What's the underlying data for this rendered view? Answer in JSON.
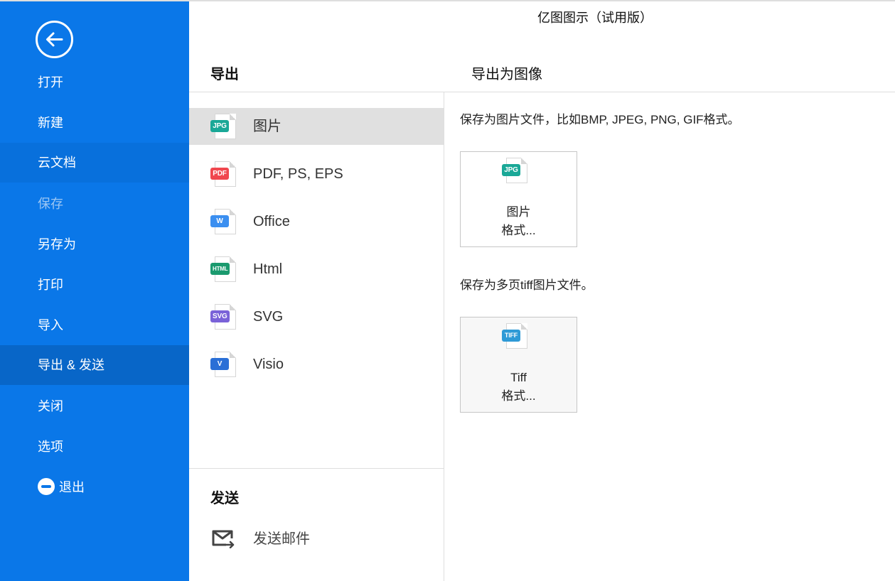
{
  "app": {
    "title": "亿图图示（试用版）"
  },
  "sidebar": {
    "back_label": "back",
    "items": [
      {
        "label": "打开",
        "state": "normal"
      },
      {
        "label": "新建",
        "state": "normal"
      },
      {
        "label": "云文档",
        "state": "hover"
      },
      {
        "label": "保存",
        "state": "disabled"
      },
      {
        "label": "另存为",
        "state": "normal"
      },
      {
        "label": "打印",
        "state": "normal"
      },
      {
        "label": "导入",
        "state": "normal"
      },
      {
        "label": "导出 & 发送",
        "state": "active"
      },
      {
        "label": "关闭",
        "state": "normal"
      },
      {
        "label": "选项",
        "state": "normal"
      },
      {
        "label": "退出",
        "state": "normal",
        "icon": "minus-circle-icon"
      }
    ]
  },
  "export": {
    "heading": "导出",
    "sub_heading": "导出为图像",
    "formats": [
      {
        "label": "图片",
        "badge": "JPG",
        "color": "#1aa897",
        "selected": true
      },
      {
        "label": "PDF, PS, EPS",
        "badge": "PDF",
        "color": "#f0474f",
        "selected": false
      },
      {
        "label": "Office",
        "badge": "W",
        "color": "#3b8ff0",
        "selected": false
      },
      {
        "label": "Html",
        "badge": "HTML",
        "color": "#1a9a6e",
        "selected": false
      },
      {
        "label": "SVG",
        "badge": "SVG",
        "color": "#7a62d8",
        "selected": false
      },
      {
        "label": "Visio",
        "badge": "V",
        "color": "#2a6fd6",
        "selected": false
      }
    ]
  },
  "send": {
    "heading": "发送",
    "mail_label": "发送邮件"
  },
  "detail": {
    "sections": [
      {
        "description": "保存为图片文件，比如BMP, JPEG, PNG, GIF格式。",
        "card": {
          "badge": "JPG",
          "color": "#1aa897",
          "line1": "图片",
          "line2": "格式..."
        }
      },
      {
        "description": "保存为多页tiff图片文件。",
        "card": {
          "badge": "TIFF",
          "color": "#2e9ad6",
          "line1": "Tiff",
          "line2": "格式..."
        }
      }
    ]
  }
}
